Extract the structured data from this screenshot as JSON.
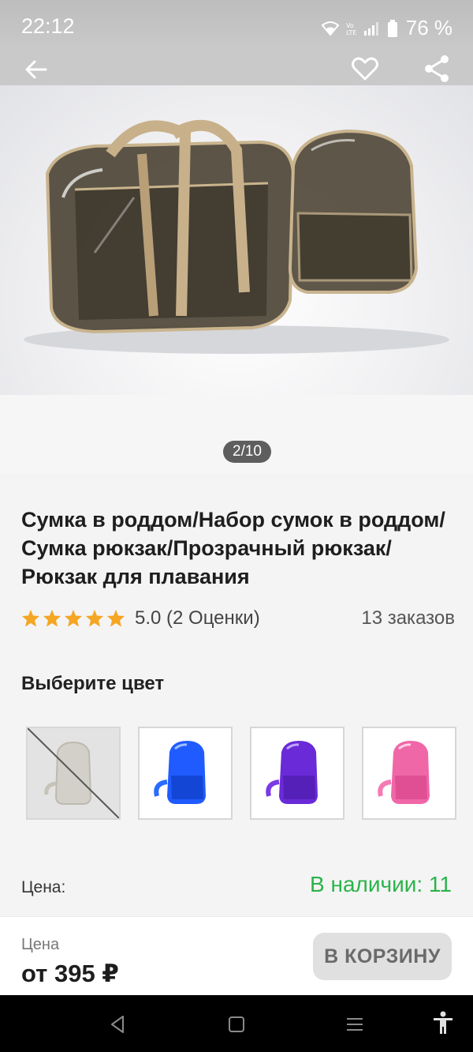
{
  "status_bar": {
    "time": "22:12",
    "battery": "76 %",
    "icons": [
      "wifi-icon",
      "volte-icon",
      "signal-icon",
      "battery-icon"
    ]
  },
  "header": {
    "icons": [
      "back-arrow-icon",
      "heart-icon",
      "share-icon"
    ]
  },
  "gallery": {
    "counter": "2/10"
  },
  "product": {
    "title": "Сумка в роддом/Набор сумок в роддом/Сумка рюкзак/Прозрачный рюкзак/Рюкзак для плавания",
    "rating_value": 5,
    "rating_text": "5.0 (2 Оценки)",
    "orders": "13 заказов",
    "star_color": "#f5a623"
  },
  "colors": {
    "heading": "Выберите цвет",
    "options": [
      {
        "color": "#cfcfcf",
        "available": false
      },
      {
        "color": "#1f5bff",
        "available": true
      },
      {
        "color": "#6a2ad8",
        "available": true
      },
      {
        "color": "#f067a8",
        "available": true
      }
    ]
  },
  "price_section": {
    "label": "Цена:",
    "stock": "В наличии: 11",
    "stock_color": "#2bb34a"
  },
  "buy_bar": {
    "label": "Цена",
    "price": "от 395 ₽",
    "cart_button": "В КОРЗИНУ"
  },
  "nav_bar": {
    "icons": [
      "nav-back-icon",
      "nav-home-icon",
      "nav-recents-icon",
      "accessibility-icon"
    ]
  }
}
